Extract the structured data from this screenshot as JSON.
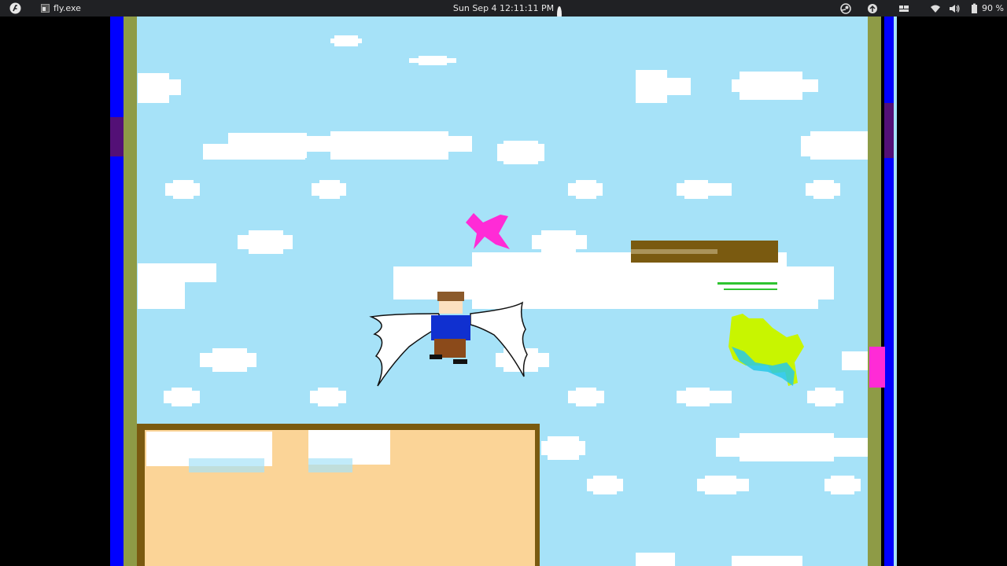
{
  "topbar": {
    "app_title": "fly.exe",
    "clock": "Sun Sep 4  12:11:11 PM",
    "battery": "90 %",
    "icons": [
      "app-logo-icon",
      "app-window-icon",
      "steam-icon",
      "update-icon",
      "window-switch-icon",
      "wifi-icon",
      "volume-icon",
      "battery-icon"
    ]
  },
  "game": {
    "colors": {
      "sky": "#a6e2f8",
      "cloud": "#ffffff",
      "edge_blue": "#0000ff",
      "edge_olive": "#8e9b46",
      "ground_fill": "#fbd497",
      "ground_border": "#7a5a10",
      "platform": "#7a5a10",
      "pickup": "#ff2bd6",
      "enemy": "#c8f500",
      "player_shirt": "#1030d0",
      "player_pants": "#8b4a1a",
      "player_hair": "#8b5a2b"
    }
  }
}
